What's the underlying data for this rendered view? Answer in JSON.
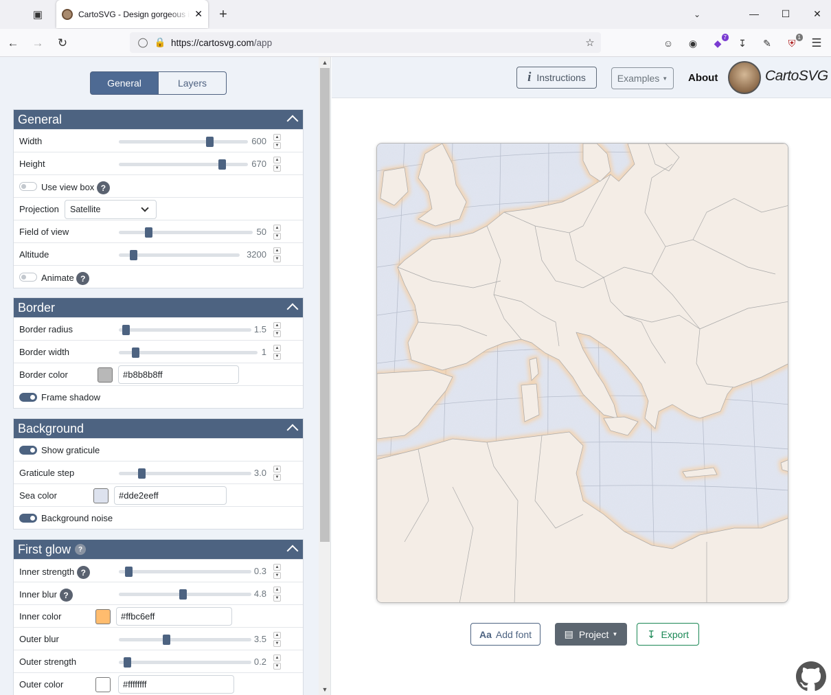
{
  "browser": {
    "tab_title": "CartoSVG - Design gorgeous interactive maps",
    "url_domain": "https://cartosvg.com",
    "url_path": "/app",
    "ext_badge_1": "7",
    "ext_badge_2": "1"
  },
  "sidebar": {
    "tabs": {
      "general": "General",
      "layers": "Layers"
    },
    "general": {
      "title": "General",
      "width": {
        "label": "Width",
        "value": "600",
        "fraction": 0.7
      },
      "height": {
        "label": "Height",
        "value": "670",
        "fraction": 0.8
      },
      "use_view_box": {
        "label": "Use view box",
        "on": false
      },
      "projection": {
        "label": "Projection",
        "value": "Satellite"
      },
      "field_of_view": {
        "label": "Field of view",
        "value": "50",
        "fraction": 0.22
      },
      "altitude": {
        "label": "Altitude",
        "value": "3200",
        "fraction": 0.12
      },
      "animate": {
        "label": "Animate",
        "on": false
      }
    },
    "border": {
      "title": "Border",
      "radius": {
        "label": "Border radius",
        "value": "1.5",
        "fraction": 0.05
      },
      "width": {
        "label": "Border width",
        "value": "1",
        "fraction": 0.12
      },
      "color": {
        "label": "Border color",
        "value": "#b8b8b8ff",
        "swatch": "#b8b8b8"
      },
      "frame_shadow": {
        "label": "Frame shadow",
        "on": true
      }
    },
    "background": {
      "title": "Background",
      "show_graticule": {
        "label": "Show graticule",
        "on": true
      },
      "graticule_step": {
        "label": "Graticule step",
        "value": "3.0",
        "fraction": 0.17
      },
      "sea_color": {
        "label": "Sea color",
        "value": "#dde2eeff",
        "swatch": "#dde2ee"
      },
      "background_noise": {
        "label": "Background noise",
        "on": true
      }
    },
    "first_glow": {
      "title": "First glow",
      "inner_strength": {
        "label": "Inner strength",
        "value": "0.3",
        "fraction": 0.07
      },
      "inner_blur": {
        "label": "Inner blur",
        "value": "4.8",
        "fraction": 0.48
      },
      "inner_color": {
        "label": "Inner color",
        "value": "#ffbc6eff",
        "swatch": "#ffbc6e"
      },
      "outer_blur": {
        "label": "Outer blur",
        "value": "3.5",
        "fraction": 0.36
      },
      "outer_strength": {
        "label": "Outer strength",
        "value": "0.2",
        "fraction": 0.06
      },
      "outer_color": {
        "label": "Outer color",
        "value": "#ffffffff",
        "swatch": "#ffffff"
      }
    }
  },
  "main": {
    "instructions": "Instructions",
    "examples": "Examples",
    "about": "About",
    "brand": "CartoSVG",
    "add_font": "Add font",
    "project": "Project",
    "export": "Export"
  },
  "colors": {
    "accent": "#4d6381",
    "land": "#f4ede6",
    "sea": "#dde2ee",
    "glow": "#ffbc6e",
    "export_green": "#198754"
  }
}
